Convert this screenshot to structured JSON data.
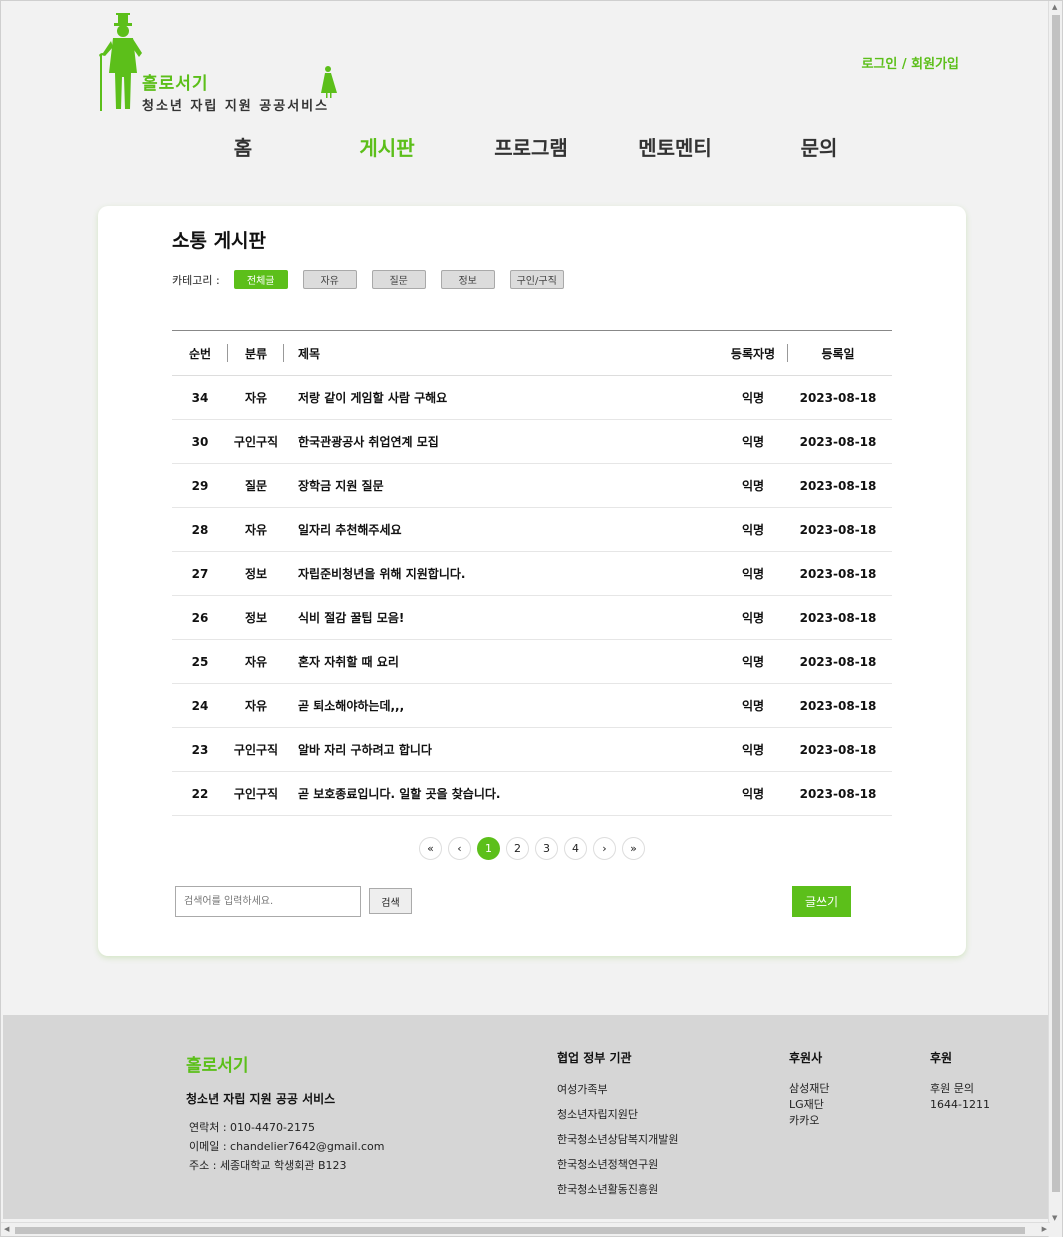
{
  "header": {
    "logo_title": "홀로서기",
    "logo_subtitle": "청소년 자립 지원 공공서비스",
    "login_link": "로그인 / 회원가입"
  },
  "nav": {
    "items": [
      {
        "label": "홈",
        "active": false
      },
      {
        "label": "게시판",
        "active": true
      },
      {
        "label": "프로그램",
        "active": false
      },
      {
        "label": "멘토멘티",
        "active": false
      },
      {
        "label": "문의",
        "active": false
      }
    ]
  },
  "board": {
    "title": "소통 게시판",
    "category_label": "카테고리 :",
    "categories": [
      "전체글",
      "자유",
      "질문",
      "정보",
      "구인/구직"
    ],
    "active_category": "전체글",
    "columns": {
      "no": "순번",
      "category": "분류",
      "title": "제목",
      "author": "등록자명",
      "date": "등록일"
    },
    "rows": [
      {
        "no": "34",
        "category": "자유",
        "title": "저랑 같이 게임할 사람 구해요",
        "author": "익명",
        "date": "2023-08-18"
      },
      {
        "no": "30",
        "category": "구인구직",
        "title": "한국관광공사 취업연계 모집",
        "author": "익명",
        "date": "2023-08-18"
      },
      {
        "no": "29",
        "category": "질문",
        "title": "장학금 지원 질문",
        "author": "익명",
        "date": "2023-08-18"
      },
      {
        "no": "28",
        "category": "자유",
        "title": "일자리 추천해주세요",
        "author": "익명",
        "date": "2023-08-18"
      },
      {
        "no": "27",
        "category": "정보",
        "title": "자립준비청년을 위해 지원합니다.",
        "author": "익명",
        "date": "2023-08-18"
      },
      {
        "no": "26",
        "category": "정보",
        "title": "식비 절감 꿀팁 모음!",
        "author": "익명",
        "date": "2023-08-18"
      },
      {
        "no": "25",
        "category": "자유",
        "title": "혼자 자취할 때 요리",
        "author": "익명",
        "date": "2023-08-18"
      },
      {
        "no": "24",
        "category": "자유",
        "title": "곧 퇴소해야하는데,,,",
        "author": "익명",
        "date": "2023-08-18"
      },
      {
        "no": "23",
        "category": "구인구직",
        "title": "알바 자리 구하려고 합니다",
        "author": "익명",
        "date": "2023-08-18"
      },
      {
        "no": "22",
        "category": "구인구직",
        "title": "곧 보호종료입니다. 일할 곳을 찾습니다.",
        "author": "익명",
        "date": "2023-08-18"
      }
    ],
    "pagination": {
      "first": "«",
      "prev": "‹",
      "next": "›",
      "last": "»",
      "pages": [
        "1",
        "2",
        "3",
        "4"
      ],
      "current": "1"
    },
    "search": {
      "placeholder": "검색어를 입력하세요.",
      "button": "검색"
    },
    "write_button": "글쓰기"
  },
  "footer": {
    "brand": "홀로서기",
    "tagline": "청소년 자립 지원 공공 서비스",
    "contact": [
      "연락처 : 010-4470-2175",
      "이메일 : chandelier7642@gmail.com",
      "주소 : 세종대학교 학생회관 B123"
    ],
    "gov_title": "협업 정부 기관",
    "gov_items": [
      "여성가족부",
      "청소년자립지원단",
      "한국청소년상담복지개발원",
      "한국청소년정책연구원",
      "한국청소년활동진흥원"
    ],
    "sponsor_title": "후원사",
    "sponsors": [
      "삼성재단",
      "LG재단",
      "카카오"
    ],
    "donate_title": "후원",
    "donate_items": [
      "후원 문의",
      "1644-1211"
    ]
  },
  "colors": {
    "accent": "#5cbf1a",
    "footer_bg": "#d6d6d6",
    "page_bg": "#f2f2f2"
  }
}
